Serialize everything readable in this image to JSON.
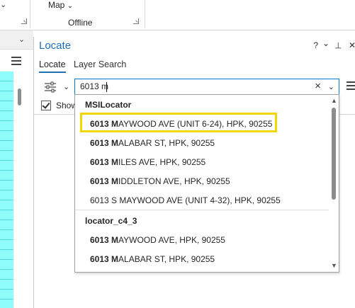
{
  "ribbon": {
    "map_label": "Map",
    "offline_label": "Offline"
  },
  "locate_pane": {
    "title": "Locate",
    "title_buttons": {
      "help": "?",
      "menu": "⌄",
      "pin": "⊣",
      "close": "✕"
    },
    "tabs": [
      {
        "label": "Locate",
        "active": true
      },
      {
        "label": "Layer Search",
        "active": false
      }
    ],
    "search": {
      "value": "6013 m",
      "clear_icon": "close-icon",
      "dropdown_icon": "chevron-down-icon"
    },
    "show_checkbox": {
      "label": "Show",
      "checked": true
    }
  },
  "suggestions": {
    "groups": [
      {
        "name": "MSILocator",
        "items": [
          {
            "bold": "6013 M",
            "rest": "AYWOOD AVE (UNIT 6-24), HPK, 90255",
            "highlighted": true
          },
          {
            "bold": "6013 M",
            "rest": "ALABAR ST, HPK, 90255"
          },
          {
            "bold": "6013 M",
            "rest": "ILES AVE, HPK, 90255"
          },
          {
            "bold": "6013 M",
            "rest": "IDDLETON AVE, HPK, 90255"
          },
          {
            "bold": "",
            "rest": "6013 S MAYWOOD AVE (UNIT 4-32), HPK, 90255"
          }
        ]
      },
      {
        "name": "locator_c4_3",
        "items": [
          {
            "bold": "6013 M",
            "rest": "AYWOOD AVE, HPK, 90255"
          },
          {
            "bold": "6013 M",
            "rest": "ALABAR ST, HPK, 90255"
          }
        ]
      }
    ]
  },
  "colors": {
    "accent": "#1f6fb5",
    "highlight": "#f2d600",
    "table_cyan": "#8ffcfc"
  }
}
